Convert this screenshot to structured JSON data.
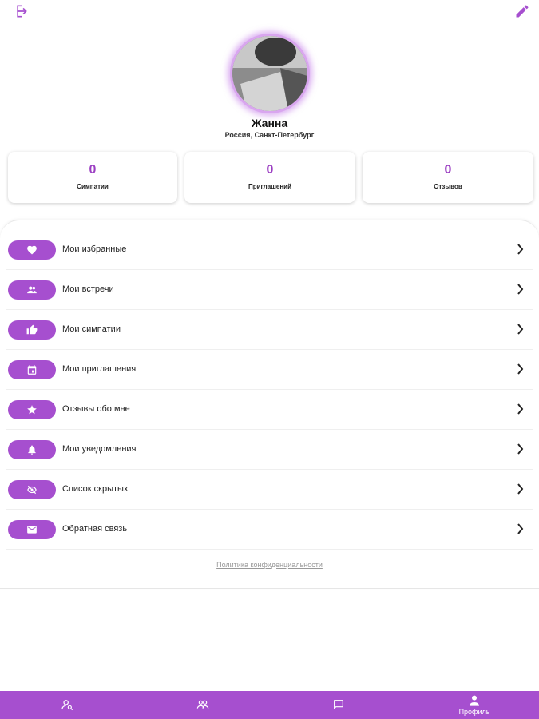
{
  "colors": {
    "accent": "#a64fcf",
    "stat_number": "#9b3ec2"
  },
  "header": {
    "left_icon": "logout-icon",
    "right_icon": "pencil-edit-icon"
  },
  "profile": {
    "name": "Жанна",
    "location": "Россия, Санкт-Петербург"
  },
  "stats": [
    {
      "value": "0",
      "label": "Симпатии"
    },
    {
      "value": "0",
      "label": "Приглашений"
    },
    {
      "value": "0",
      "label": "Отзывов"
    }
  ],
  "menu": [
    {
      "label": "Мои избранные",
      "icon": "heart-icon"
    },
    {
      "label": "Мои встречи",
      "icon": "people-icon"
    },
    {
      "label": "Мои симпатии",
      "icon": "thumb-up-icon"
    },
    {
      "label": "Мои приглашения",
      "icon": "calendar-icon"
    },
    {
      "label": "Отзывы обо мне",
      "icon": "star-icon"
    },
    {
      "label": "Мои уведомления",
      "icon": "bell-icon"
    },
    {
      "label": "Список скрытых",
      "icon": "eye-off-icon"
    },
    {
      "label": "Обратная связь",
      "icon": "mail-icon"
    }
  ],
  "privacy_link": "Политика конфиденциальности",
  "bottom_nav": [
    {
      "icon": "person-search-icon",
      "label": ""
    },
    {
      "icon": "group-icon",
      "label": ""
    },
    {
      "icon": "chat-icon",
      "label": ""
    },
    {
      "icon": "profile-icon",
      "label": "Профиль",
      "active": true
    }
  ]
}
